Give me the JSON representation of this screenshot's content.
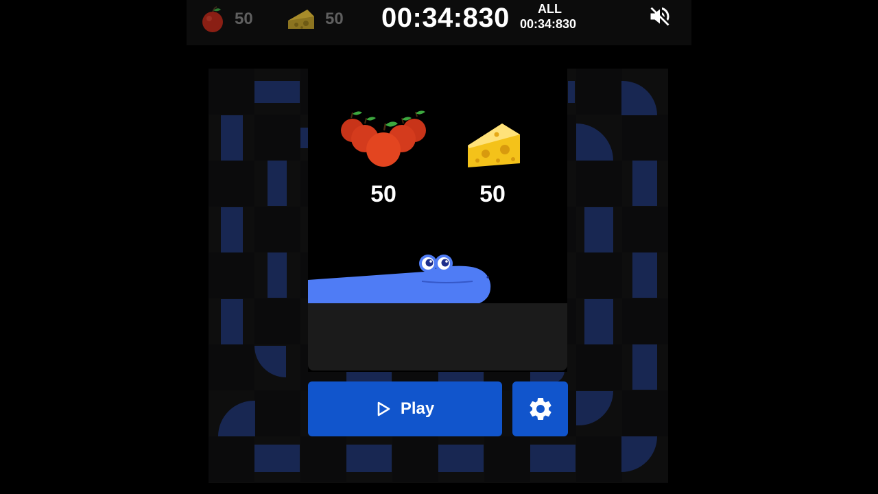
{
  "hud": {
    "apple_count": "50",
    "cheese_count": "50",
    "timer": "00:34:830",
    "all_label": "ALL",
    "all_time": "00:34:830",
    "mute_icon": "volume-muted-icon"
  },
  "modal": {
    "apple_count": "50",
    "cheese_count": "50",
    "play_label": "Play",
    "play_icon": "play-triangle-icon",
    "settings_icon": "gear-icon"
  },
  "colors": {
    "background": "#000000",
    "board_tile": "#1a2b5e",
    "button": "#1155cc",
    "snake": "#4f7cf5",
    "hud_count": "#5f5f5f"
  }
}
